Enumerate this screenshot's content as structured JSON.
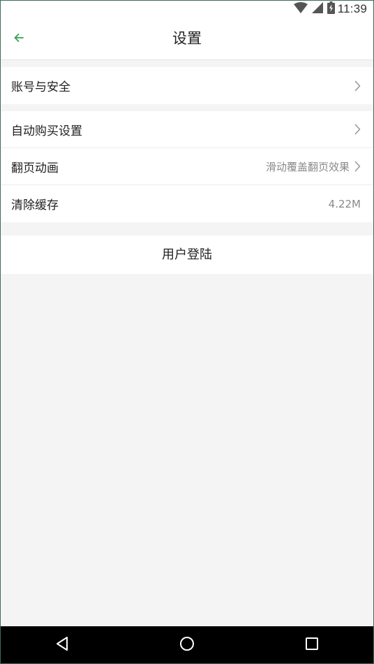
{
  "status_bar": {
    "time": "11:39",
    "icons": [
      "wifi-icon",
      "cell-signal-icon",
      "battery-icon"
    ]
  },
  "app_bar": {
    "title": "设置",
    "back_icon": "arrow-left-icon",
    "accent_color": "#2ea44f"
  },
  "settings": {
    "account_security": {
      "label": "账号与安全"
    },
    "auto_purchase": {
      "label": "自动购买设置"
    },
    "page_turn_animation": {
      "label": "翻页动画",
      "value": "滑动覆盖翻页效果"
    },
    "clear_cache": {
      "label": "清除缓存",
      "value": "4.22M"
    }
  },
  "login_button": {
    "label": "用户登陆"
  },
  "nav_bar": {
    "icons": [
      "back-triangle-icon",
      "home-circle-icon",
      "recents-square-icon"
    ]
  }
}
